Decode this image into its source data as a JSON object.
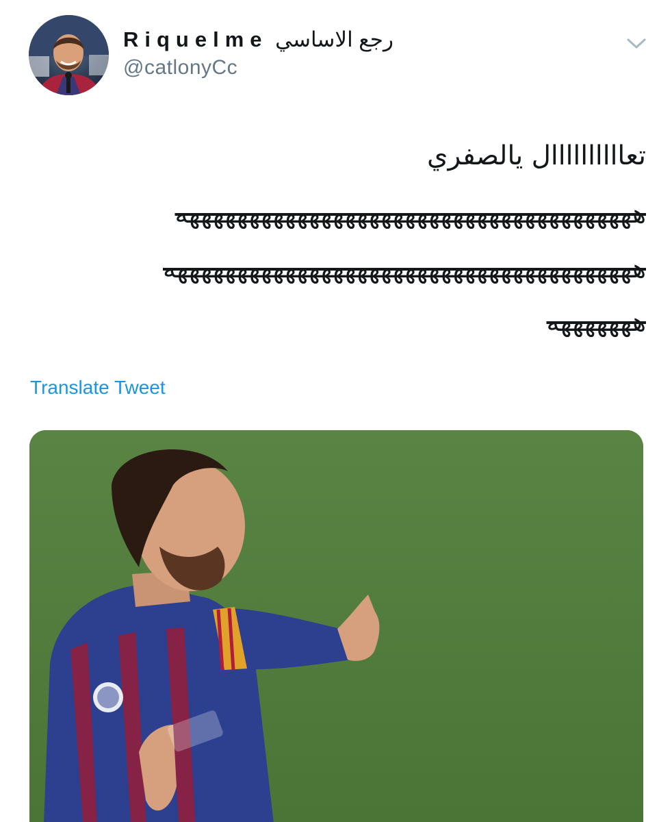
{
  "author": {
    "name_latin": "Riquelme",
    "name_arabic": "رجع الاساسي",
    "handle": "@catlonyCc"
  },
  "icons": {
    "avatar": "profile-photo",
    "menu": "chevron-down-icon"
  },
  "tweet": {
    "line1": "تعاااااااااال يالصفري",
    "line2": "ههههههههههههههههههههههههههههههههههههههه",
    "line3": "هههههههههههههههههههههههههههههههههههههههه",
    "line4": "هههههههه"
  },
  "translate_label": "Translate Tweet",
  "colors": {
    "text": "#14171a",
    "secondary": "#657786",
    "link": "#1b95e0",
    "pitch": "#4f7a3a"
  }
}
